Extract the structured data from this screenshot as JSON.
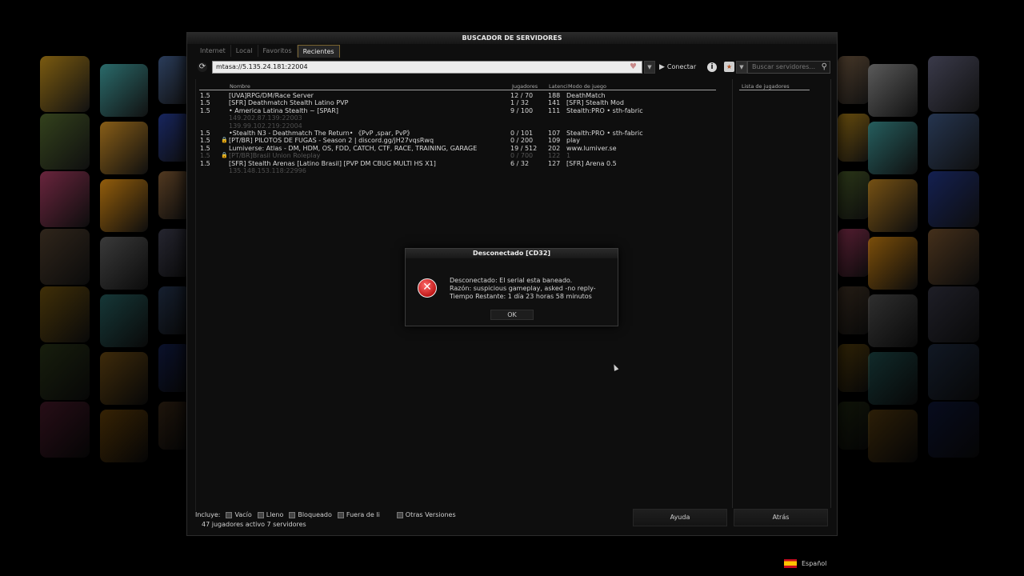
{
  "window": {
    "title": "BUSCADOR DE SERVIDORES"
  },
  "tabs": [
    {
      "label": "Internet",
      "active": false
    },
    {
      "label": "Local",
      "active": false
    },
    {
      "label": "Favoritos",
      "active": false
    },
    {
      "label": "Recientes",
      "active": true
    }
  ],
  "address": {
    "value": "mtasa://5.135.24.181:22004"
  },
  "toolbar": {
    "connect_label": "Conectar",
    "search_placeholder": "Buscar servidores..."
  },
  "columns": {
    "name": "Nombre",
    "players": "Jugadores",
    "ping": "Latenci",
    "mode": "Modo de juego",
    "player_list": "Lista de jugadores"
  },
  "servers": [
    {
      "version": "1.5",
      "locked": false,
      "name": "[UVA]RPG/DM/Race Server",
      "players": "12 / 70",
      "ping": "188",
      "mode": "DeathMatch",
      "sub": "",
      "dim": false
    },
    {
      "version": "1.5",
      "locked": false,
      "name": "[SFR] Deathmatch Stealth Latino PVP",
      "players": "1 / 32",
      "ping": "141",
      "mode": "[SFR] Stealth Mod",
      "sub": "",
      "dim": false
    },
    {
      "version": "1.5",
      "locked": false,
      "name": "•     America Latina Stealth ~ [SPAR]",
      "players": "9 / 100",
      "ping": "111",
      "mode": "Stealth:PRO • sth-fabric",
      "sub": "149.202.87.139:22003",
      "dim": false
    },
    {
      "version": "",
      "locked": false,
      "name": "",
      "players": "",
      "ping": "",
      "mode": "",
      "sub": "139.99.102.219:22004",
      "dim": true,
      "only_sub": true
    },
    {
      "version": "1.5",
      "locked": false,
      "name": "     •Stealth N3 - Deathmatch The Return•  《PvP ,spar, PvP》",
      "players": "0 / 101",
      "ping": "107",
      "mode": "Stealth:PRO • sth-fabric",
      "sub": "",
      "dim": false
    },
    {
      "version": "1.5",
      "locked": true,
      "name": "[PT/BR] PILOTOS DE FUGAS - Season 2 | discord.gg/jH27vqsRwq",
      "players": "0 / 200",
      "ping": "109",
      "mode": "play",
      "sub": "",
      "dim": false
    },
    {
      "version": "1.5",
      "locked": false,
      "name": "Lumiverse: Atlas - DM, HDM, OS, FDD, CATCH, CTF, RACE, TRAINING, GARAGE",
      "players": "19 / 512",
      "ping": "202",
      "mode": "www.lumiver.se",
      "sub": "",
      "dim": false
    },
    {
      "version": "1.5",
      "locked": true,
      "name": "[PT/BR]Brasil Union Roleplay",
      "players": "0 / 700",
      "ping": "122",
      "mode": "1",
      "sub": "",
      "dim": true
    },
    {
      "version": "1.5",
      "locked": false,
      "name": "[SFR] Stealth Arenas [Latino Brasil] [PVP DM CBUG MULTI HS X1]",
      "players": "6 / 32",
      "ping": "127",
      "mode": "[SFR] Arena 0.5",
      "sub": "135.148.153.118:22996",
      "dim": false
    }
  ],
  "filters": {
    "label": "Incluye:",
    "items": [
      "Vacío",
      "Lleno",
      "Bloqueado",
      "Fuera de li",
      "Otras Versiones"
    ]
  },
  "status": "47 jugadores activo 7 servidores",
  "buttons": {
    "help": "Ayuda",
    "back": "Atrás"
  },
  "dialog": {
    "title": "Desconectado [CD32]",
    "line1": "Desconectado: El serial esta baneado.",
    "line2": "Razón: suspicious gameplay, asked -no reply-",
    "line3": "Tiempo Restante: 1 día 23 horas 58 minutos",
    "ok": "OK"
  },
  "language": "Español",
  "colors": {
    "accent_tab_border": "#7a6430",
    "error_red": "#c01818"
  }
}
